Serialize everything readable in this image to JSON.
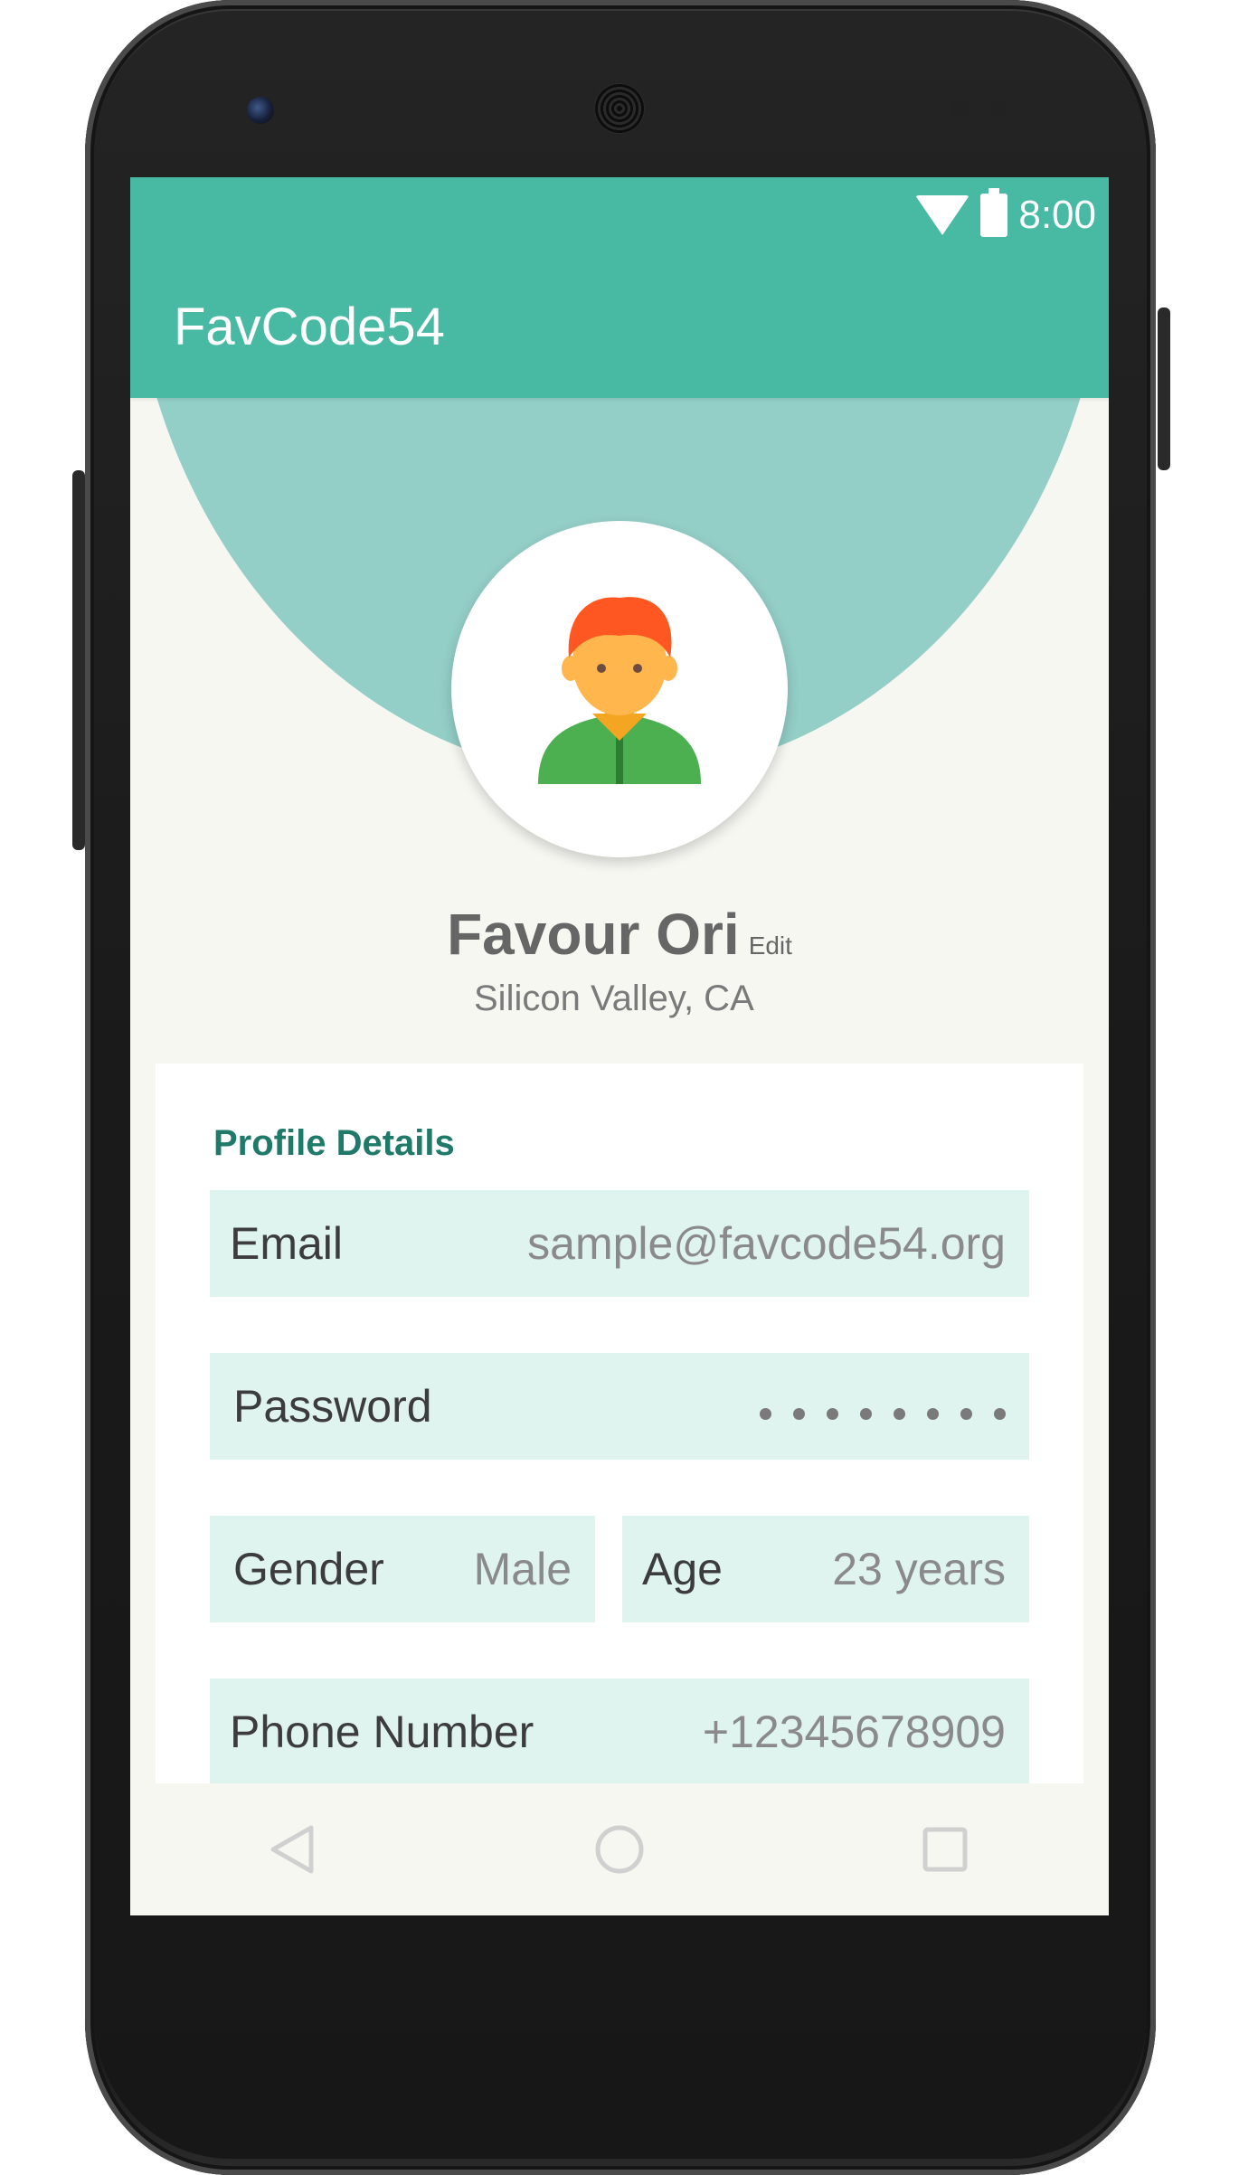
{
  "status_bar": {
    "time": "8:00",
    "icons": [
      "wifi-icon",
      "battery-icon"
    ]
  },
  "app_bar": {
    "title": "FavCode54"
  },
  "profile": {
    "avatar": "user-avatar-icon",
    "name": "Favour Ori",
    "edit_label": "Edit",
    "location": "Silicon Valley, CA"
  },
  "details": {
    "section_title": "Profile Details",
    "email": {
      "label": "Email",
      "value": "sample@favcode54.org"
    },
    "password": {
      "label": "Password",
      "masked_length": 8
    },
    "gender": {
      "label": "Gender",
      "value": "Male"
    },
    "age": {
      "label": "Age",
      "value": "23 years"
    },
    "phone": {
      "label": "Phone Number",
      "value": "+12345678909"
    }
  },
  "nav_bar": {
    "icons": [
      "back-icon",
      "home-icon",
      "recents-icon"
    ]
  },
  "colors": {
    "primary": "#48baa3",
    "header_arc": "#93cec7",
    "field_background": "#dff3ef",
    "section_title": "#1f7a6a",
    "screen_background": "#f7f7f2"
  }
}
